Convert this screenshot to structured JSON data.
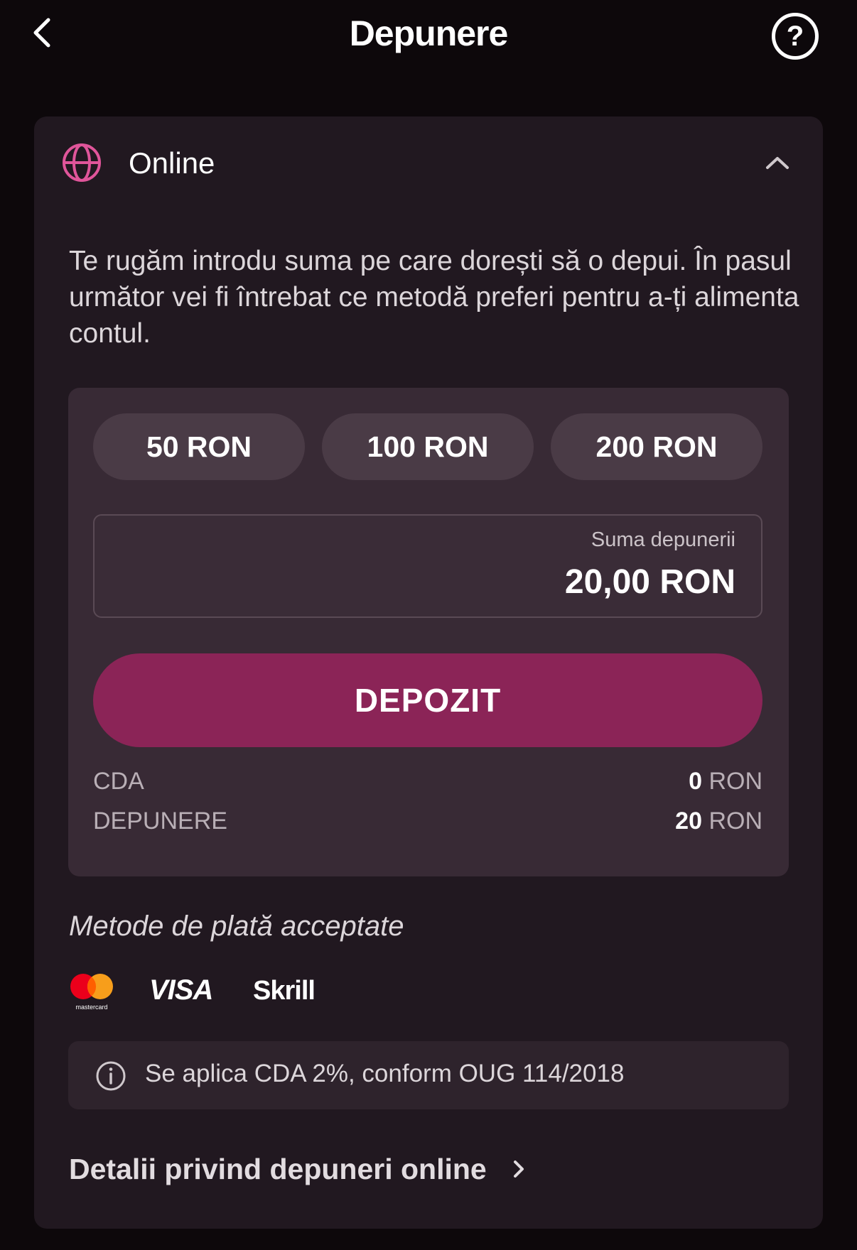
{
  "header": {
    "title": "Depunere",
    "back_icon": "chevron-left-icon",
    "help_label": "?"
  },
  "section": {
    "title": "Online",
    "icon": "globe-icon",
    "expanded": true,
    "intro": "Te rugăm introdu suma pe care dorești să o depui. În pasul următor vei fi întrebat ce metodă preferi pentru a-ți alimenta contul."
  },
  "presets": [
    "50 RON",
    "100 RON",
    "200 RON"
  ],
  "amount_field": {
    "label": "Suma depunerii",
    "value": "20,00 RON"
  },
  "deposit_button": {
    "label": "DEPOZIT"
  },
  "summary": [
    {
      "label": "CDA",
      "amount": "0",
      "currency": "RON"
    },
    {
      "label": "DEPUNERE",
      "amount": "20",
      "currency": "RON"
    }
  ],
  "payment_methods": {
    "title": "Metode de plată acceptate",
    "mastercard_caption": "mastercard",
    "visa": "VISA",
    "skrill": "Skrill"
  },
  "info": {
    "text": "Se aplica CDA 2%, conform OUG 114/2018"
  },
  "details_link": {
    "label": "Detalii privind depuneri online"
  },
  "colors": {
    "page_bg": "#0d080b",
    "card_bg": "#211820",
    "accent": "#8b2457",
    "globe": "#e0559a"
  }
}
